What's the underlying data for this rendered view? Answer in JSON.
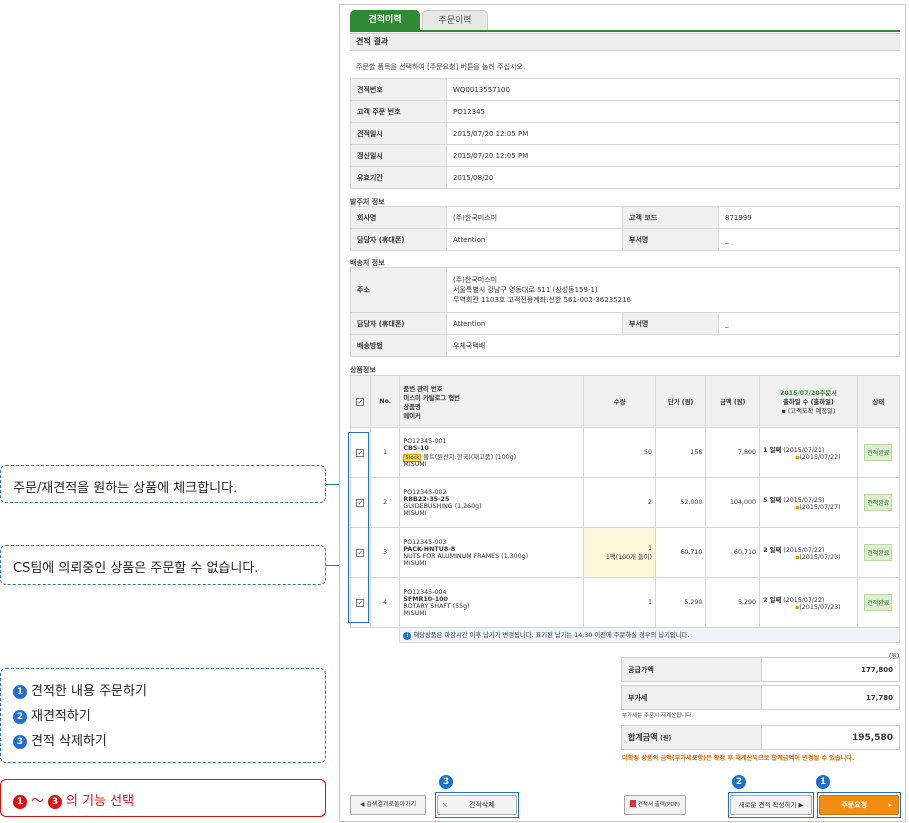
{
  "tabs": {
    "active": "견적이력",
    "inactive": "주문이력"
  },
  "section_title": "견적 결과",
  "instruction": "주문할 품목을 선택하여 [주문요청] 버튼을 눌러 주십시오.",
  "summary": [
    {
      "label": "견적번호",
      "value": "WQ0013557100"
    },
    {
      "label": "고객 주문 번호",
      "value": "PO12345"
    },
    {
      "label": "견적일시",
      "value": "2015/07/20 12:05 PM"
    },
    {
      "label": "갱신일시",
      "value": "2015/07/20 12:05 PM"
    },
    {
      "label": "유효기간",
      "value": "2015/08/20"
    }
  ],
  "orderer": {
    "title": "발주처 정보",
    "company_label": "회사명",
    "company": "(주)한국미스미",
    "code_label": "고객 코드",
    "code": "871999",
    "person_label": "담당자 (휴대폰)",
    "person": "Attention",
    "dept_label": "부서명",
    "dept": "_"
  },
  "shipping": {
    "title": "배송처 정보",
    "address_label": "주소",
    "address_1": "(주)한국미스미",
    "address_2": "서울특별시 강남구 영동대로 511 (삼성동159-1)",
    "address_3": "무역회관 1103호 고객전용계좌:신한 561-002-36235216",
    "person_label": "담당자 (휴대폰)",
    "person": "Attention",
    "dept_label": "부서명",
    "dept": "_",
    "method_label": "배송방법",
    "method": "우체국택배"
  },
  "products": {
    "title": "상품정보",
    "headers": {
      "no": "No.",
      "item_1": "품번 관리 번호",
      "item_2": "미스미 카탈로그 형번",
      "item_3": "상품명",
      "item_4": "메이커",
      "qty": "수량",
      "unit_price": "단가 (원)",
      "amount": "금액 (원)",
      "ship_date": "2015/07/20주문시",
      "ship_days": "출하일 수 (출하일)",
      "ship_arrival": "▪ (고객도착 예정일)",
      "status": "상태"
    },
    "rows": [
      {
        "no": "1",
        "po": "PO12345-001",
        "code": "CBS-10",
        "badge": "Stock",
        "name": "볼트(원산지:한국)(재고품) (100g)",
        "maker": "MISUMI",
        "qty": "50",
        "qty_note": "",
        "unit": "156",
        "amount": "7,800",
        "days": "1 일째",
        "ship": "(2015/07/21)",
        "arrive": "(2015/07/22)",
        "status": "견적완료"
      },
      {
        "no": "2",
        "po": "PO12345-002",
        "code": "RBB22-35-25",
        "badge": "",
        "name": "GUIDEBUSHING (1,260g)",
        "maker": "MISUMI",
        "qty": "2",
        "qty_note": "",
        "unit": "52,000",
        "amount": "104,000",
        "days": "5 일째",
        "ship": "(2015/07/25)",
        "arrive": "(2015/07/27)",
        "status": "견적완료"
      },
      {
        "no": "3",
        "po": "PO12345-003",
        "code": "PACK-HNTU8-8",
        "badge": "",
        "name": "NUTS FOR ALUMINUM FRAMES (1,300g)",
        "maker": "MISUMI",
        "qty": "1",
        "qty_note": "1팩(100개 들이)",
        "unit": "60,710",
        "amount": "60,710",
        "days": "2 일째",
        "ship": "(2015/07/22)",
        "arrive": "(2015/07/23)",
        "status": "견적완료"
      },
      {
        "no": "4",
        "po": "PO12345-004",
        "code": "SFMR10-100",
        "badge": "",
        "name": "ROTARY SHAFT (55g)",
        "maker": "MISUMI",
        "qty": "1",
        "qty_note": "",
        "unit": "5,290",
        "amount": "5,290",
        "days": "2 일째",
        "ship": "(2015/07/22)",
        "arrive": "(2015/07/23)",
        "status": "견적완료"
      }
    ],
    "info": "해당상품은 마감시간 이후 납기가 변경됩니다. 표기된 납기는 14:30 이전에 주문하실 경우의 납기입니다."
  },
  "totals": {
    "unit_note": "(원)",
    "supply_label": "공급가액",
    "supply": "177,800",
    "vat_label": "부가세",
    "vat": "17,780",
    "vat_note": "부가세는 주문시 재계산됩니다.",
    "total_label": "합계금액",
    "total_unit": "(원)",
    "total": "195,580",
    "warning": "미확정 상품의 금액(부가세포함)은 확정 후 재계산되므로 합계금액이 변경될 수 있습니다."
  },
  "buttons": {
    "back": "◀ 검색결과로돌아가기",
    "delete": "견적삭제",
    "pdf": "견적서 출력(PDF)",
    "requote": "새로운 견적 작성하기 ▶",
    "order": "주문요청"
  },
  "callouts": {
    "check": "주문/재견적을 원하는 상품에 체크합니다.",
    "cs": "CS팀에 의뢰중인 상품은 주문할 수 없습니다.",
    "func_1": "견적한 내용 주문하기",
    "func_2": "재견적하기",
    "func_3": "견적 삭제하기",
    "select": "의 기능 선택",
    "select_range": "〜"
  },
  "markers": {
    "one": "1",
    "two": "2",
    "three": "3"
  }
}
